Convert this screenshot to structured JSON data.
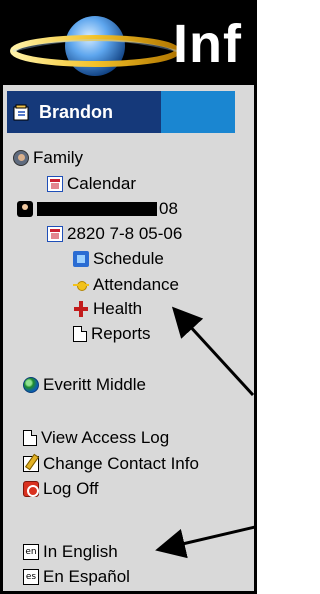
{
  "header": {
    "brand_text": "Inf"
  },
  "student": {
    "name": "Brandon"
  },
  "nav": {
    "family": "Family",
    "calendar": "Calendar",
    "student_suffix": "08",
    "section": "2820 7-8 05-06",
    "schedule": "Schedule",
    "attendance": "Attendance",
    "health": "Health",
    "reports": "Reports",
    "school": "Everitt Middle",
    "view_access_log": "View Access Log",
    "change_contact_info": "Change Contact Info",
    "log_off": "Log Off",
    "english": "In English",
    "spanish": "En Español"
  },
  "icons": {
    "english_code": "en",
    "spanish_code": "es"
  },
  "colors": {
    "student_bar_dark": "#15397a",
    "student_bar_light": "#1a86d1",
    "panel_bg": "#d9d9d9"
  }
}
